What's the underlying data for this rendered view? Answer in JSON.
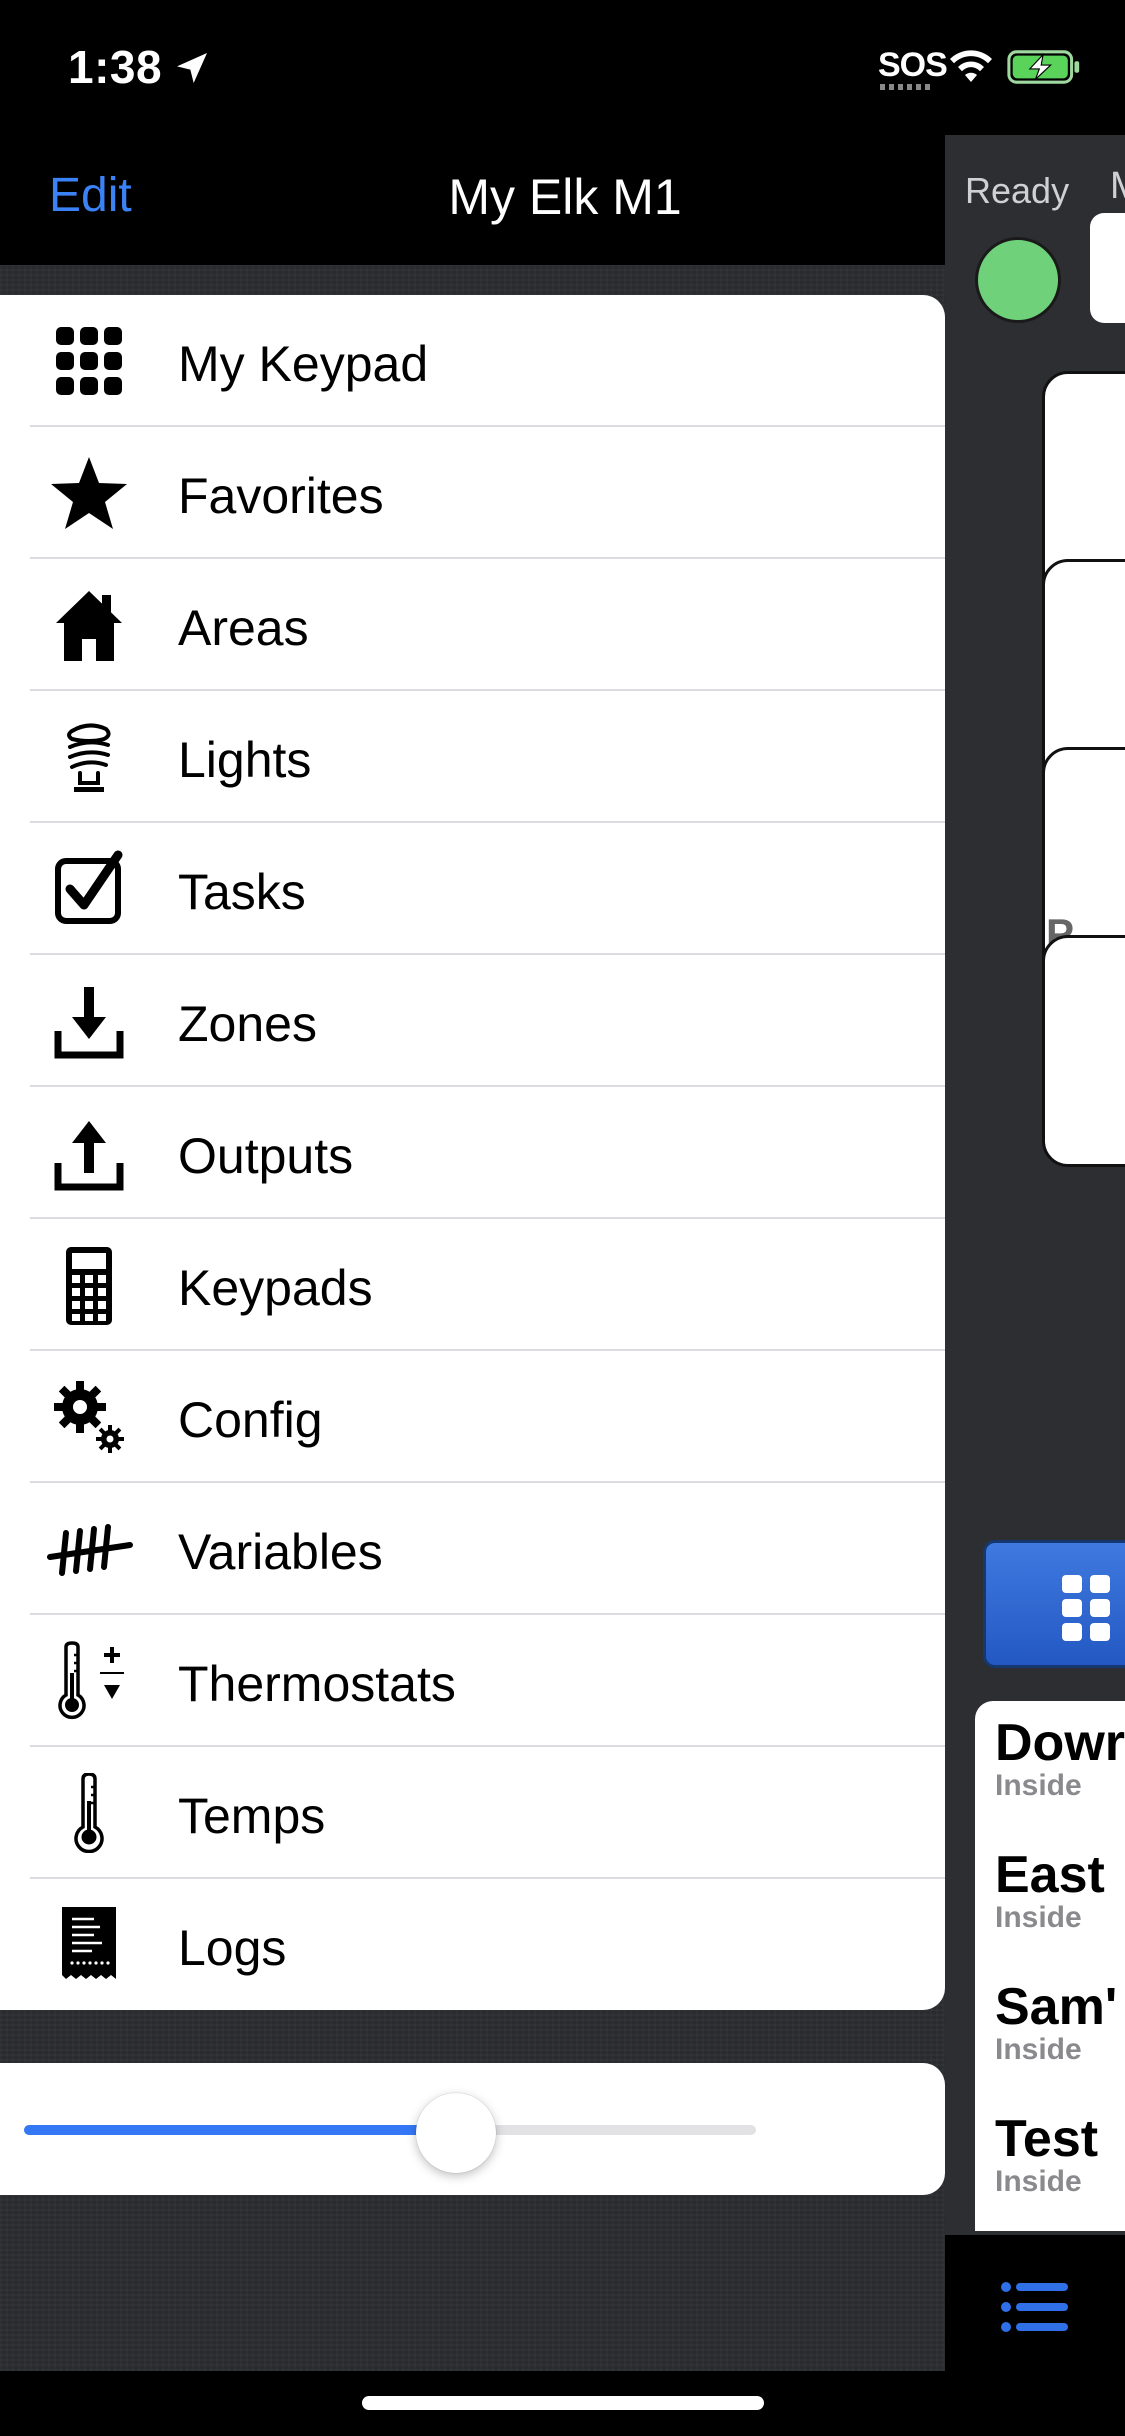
{
  "status_bar": {
    "time": "1:38",
    "carrier": "SOS",
    "icons": [
      "location-arrow-icon",
      "wifi-icon",
      "battery-charging-icon"
    ]
  },
  "nav": {
    "edit_label": "Edit",
    "title": "My Elk M1"
  },
  "menu": {
    "items": [
      {
        "label": "My Keypad",
        "icon": "keypad-grid-icon"
      },
      {
        "label": "Favorites",
        "icon": "star-icon"
      },
      {
        "label": "Areas",
        "icon": "house-icon"
      },
      {
        "label": "Lights",
        "icon": "light-bulb-icon"
      },
      {
        "label": "Tasks",
        "icon": "checkbox-icon"
      },
      {
        "label": "Zones",
        "icon": "download-tray-icon"
      },
      {
        "label": "Outputs",
        "icon": "upload-tray-icon"
      },
      {
        "label": "Keypads",
        "icon": "calculator-icon"
      },
      {
        "label": "Config",
        "icon": "gears-icon"
      },
      {
        "label": "Variables",
        "icon": "tally-marks-icon"
      },
      {
        "label": "Thermostats",
        "icon": "thermostat-icon"
      },
      {
        "label": "Temps",
        "icon": "thermometer-icon"
      },
      {
        "label": "Logs",
        "icon": "receipt-log-icon"
      }
    ]
  },
  "slider": {
    "value": 0.59,
    "accent": "#3478f6"
  },
  "background_panel": {
    "status_label": "Ready",
    "truncated_label": "M",
    "ready_color": "#6fd17a",
    "card_partial_text": "P",
    "list": [
      {
        "name": "Dowr",
        "sub": "Inside"
      },
      {
        "name": "East",
        "sub": "Inside"
      },
      {
        "name": "Sam'",
        "sub": "Inside"
      },
      {
        "name": "Test",
        "sub": "Inside"
      }
    ]
  },
  "colors": {
    "accent_blue": "#3b82f6",
    "nav_background": "#000000",
    "backdrop": "#2b2c2f"
  }
}
